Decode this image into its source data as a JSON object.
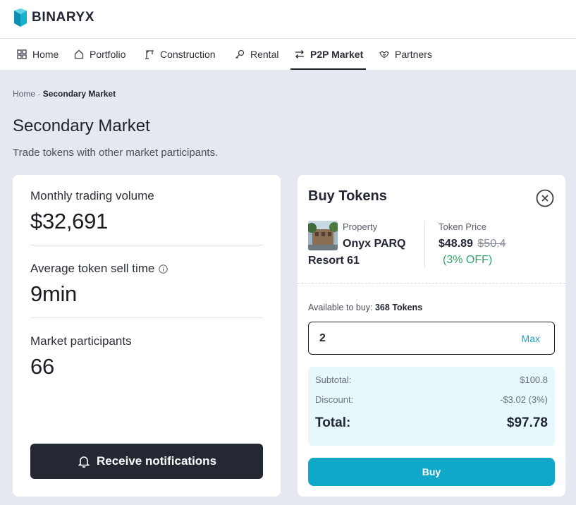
{
  "app": {
    "logo_text": "BINARYX"
  },
  "nav": {
    "items": [
      {
        "label": "Home",
        "icon": "grid-icon"
      },
      {
        "label": "Portfolio",
        "icon": "house-icon"
      },
      {
        "label": "Construction",
        "icon": "crane-icon"
      },
      {
        "label": "Rental",
        "icon": "key-icon"
      },
      {
        "label": "P2P Market",
        "icon": "swap-arrows-icon",
        "active": true
      },
      {
        "label": "Partners",
        "icon": "handshake-icon"
      }
    ]
  },
  "breadcrumb": {
    "home": "Home",
    "separator": "·",
    "current": "Secondary Market"
  },
  "page": {
    "title": "Secondary Market",
    "subtitle": "Trade tokens with other market participants."
  },
  "stats": {
    "volume": {
      "label": "Monthly trading volume",
      "value": "$32,691"
    },
    "sell_time": {
      "label": "Average token sell time",
      "value": "9min",
      "icon": "info-icon"
    },
    "participants": {
      "label": "Market participants",
      "value": "66"
    },
    "notify_label": "Receive notifications"
  },
  "buy": {
    "title": "Buy Tokens",
    "property_label": "Property",
    "property_name_line1": "Onyx PARQ",
    "property_name_line2": "Resort 61",
    "price_label": "Token Price",
    "price": "$48.89",
    "old_price": "$50.4",
    "discount": "(3% OFF)",
    "available_label": "Available to buy:",
    "available_value": "368 Tokens",
    "quantity": "2",
    "max_label": "Max",
    "subtotal_label": "Subtotal:",
    "subtotal_value": "$100.8",
    "discount_label": "Discount:",
    "discount_value": "-$3.02 (3%)",
    "total_label": "Total:",
    "total_value": "$97.78",
    "buy_label": "Buy"
  },
  "colors": {
    "brand": "#10a8c8",
    "dark_button": "#232833",
    "discount_green": "#2fa66a",
    "page_background": "#e5e8f0"
  }
}
